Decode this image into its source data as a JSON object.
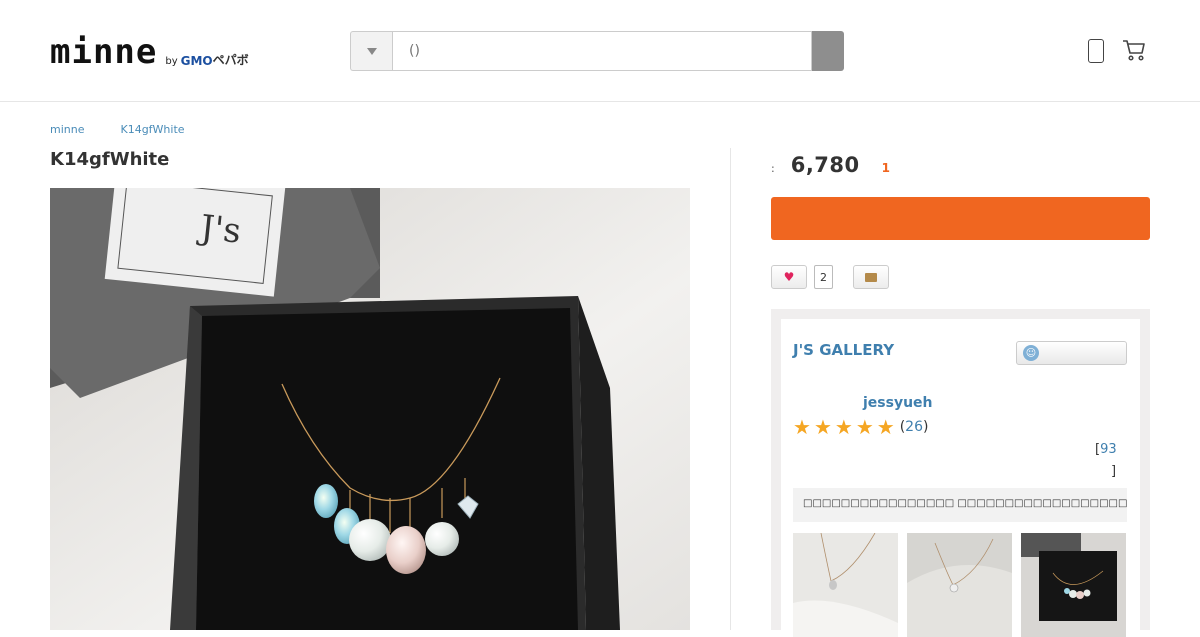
{
  "header": {
    "logo_word": "minne",
    "logo_by": "by",
    "logo_brand_a": "GMO",
    "logo_brand_b": "ペパボ",
    "search_placeholder": "()"
  },
  "breadcrumb": [
    "minne",
    "K14gfWhite"
  ],
  "product": {
    "title": "K14gfWhite",
    "price_label": ":",
    "price": "6,780",
    "stock": "1",
    "like_count": "2"
  },
  "shop": {
    "name": "J'S GALLERY",
    "owner": "jessyueh",
    "rating_stars": 5,
    "review_count_open": "(",
    "review_count": "26",
    "review_count_close": ")",
    "item_count_open": "[",
    "item_count": "93",
    "item_count_close": "]",
    "description": "□□□□□□□□□□□□□□□□ □□□□□□□□□□□□□□□□□□□□↗□"
  },
  "colors": {
    "accent_orange": "#f06620",
    "link_blue": "#3f7fae",
    "star_gold": "#f5a623"
  },
  "icons": [
    "chevron-down-icon",
    "phone-icon",
    "cart-icon",
    "heart-icon",
    "envelope-icon",
    "smile-icon",
    "star-icon"
  ]
}
